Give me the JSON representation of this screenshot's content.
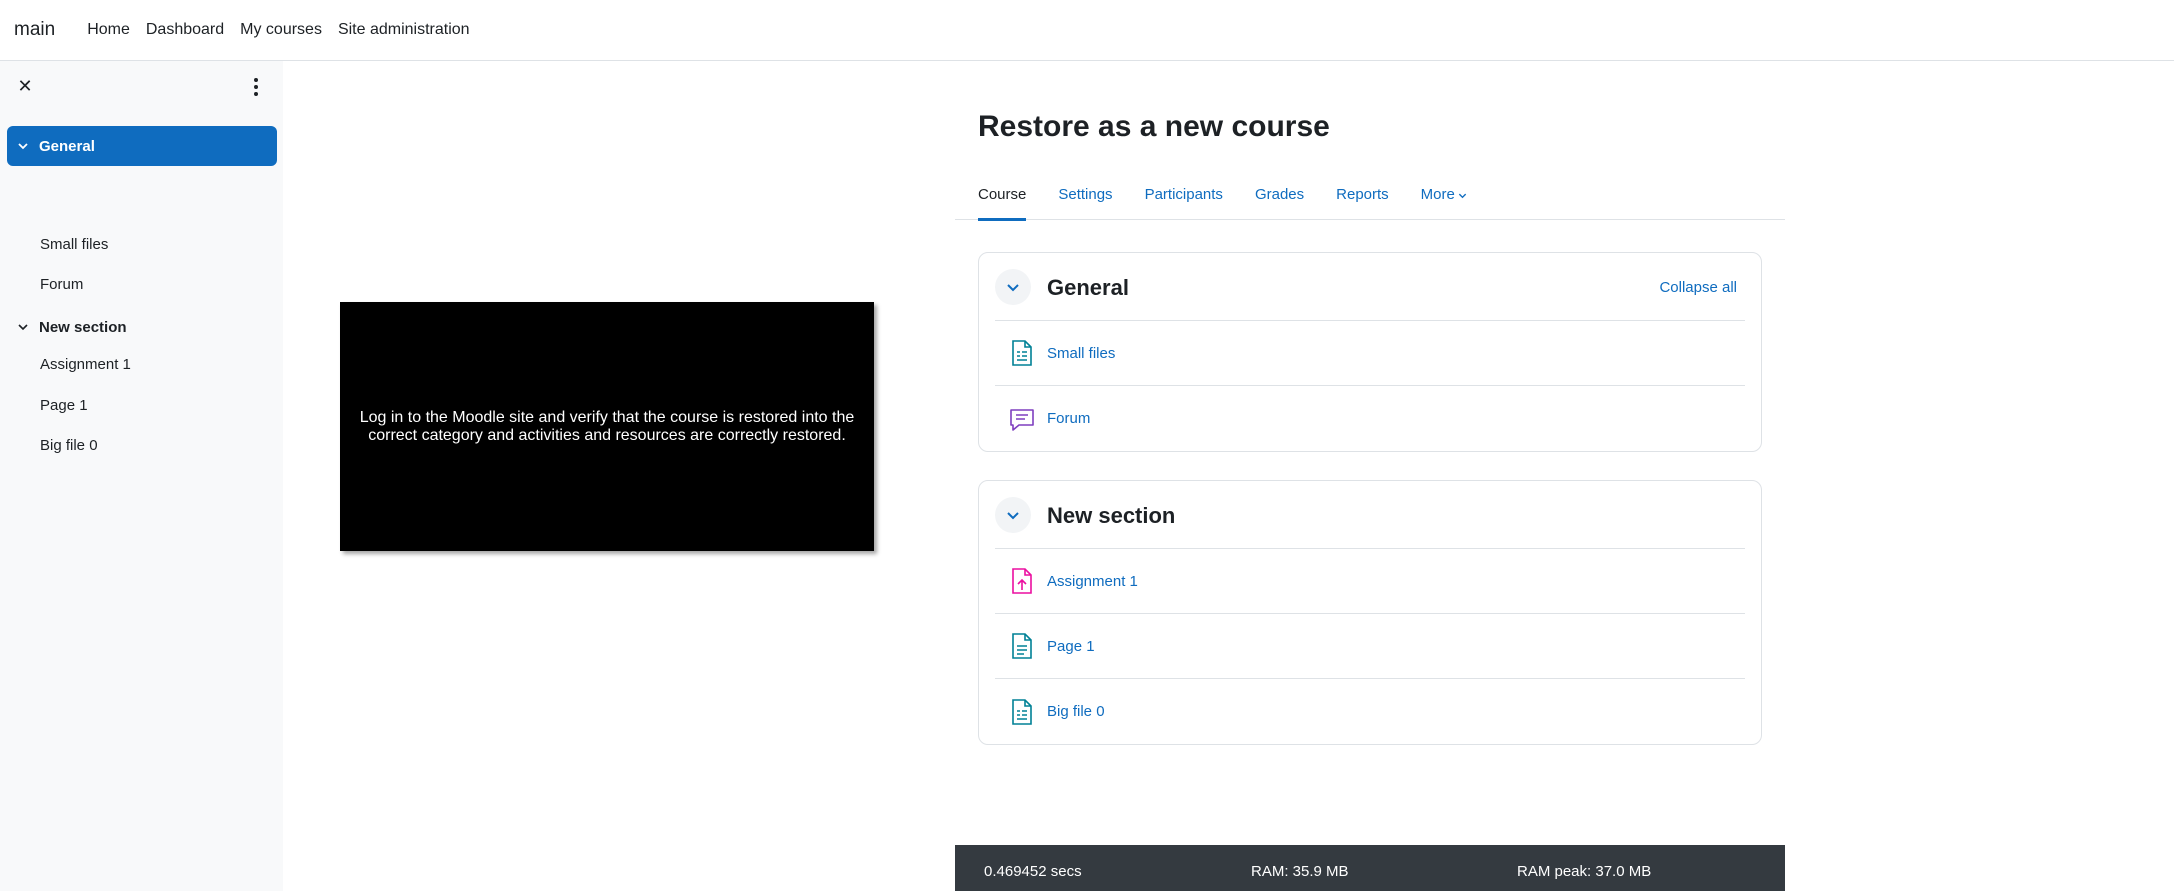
{
  "navbar": {
    "brand": "main",
    "links": [
      "Home",
      "Dashboard",
      "My courses",
      "Site administration"
    ]
  },
  "drawer": {
    "close_icon": "close-icon",
    "menu_icon": "kebab-icon",
    "sections": [
      {
        "label": "General",
        "active": true,
        "items": [
          "Small files",
          "Forum"
        ]
      },
      {
        "label": "New section",
        "active": false,
        "items": [
          "Assignment 1",
          "Page 1",
          "Big file 0"
        ]
      }
    ]
  },
  "video": {
    "text": "Log in to the Moodle site and verify that the course is restored into the correct category and  activities and resources are correctly restored."
  },
  "main": {
    "title": "Restore as a new course",
    "tabs": [
      "Course",
      "Settings",
      "Participants",
      "Grades",
      "Reports",
      "More"
    ],
    "collapse_all": "Collapse all",
    "sections": [
      {
        "title": "General",
        "activities": [
          {
            "name": "Small files",
            "icon": "file-icon",
            "color": "#008196"
          },
          {
            "name": "Forum",
            "icon": "forum-icon",
            "color": "#7f3fbf"
          }
        ]
      },
      {
        "title": "New section",
        "activities": [
          {
            "name": "Assignment 1",
            "icon": "assignment-icon",
            "color": "#eb0fa0"
          },
          {
            "name": "Page 1",
            "icon": "page-icon",
            "color": "#008196"
          },
          {
            "name": "Big file 0",
            "icon": "file-icon",
            "color": "#008196"
          }
        ]
      }
    ]
  },
  "footer": {
    "time": "0.469452 secs",
    "ram": "RAM: 35.9 MB",
    "ram_peak": "RAM peak: 37.0 MB"
  },
  "colors": {
    "primary": "#0f6cbf",
    "drawer_bg": "#f8f9fa",
    "footer_bg": "#343a40"
  }
}
